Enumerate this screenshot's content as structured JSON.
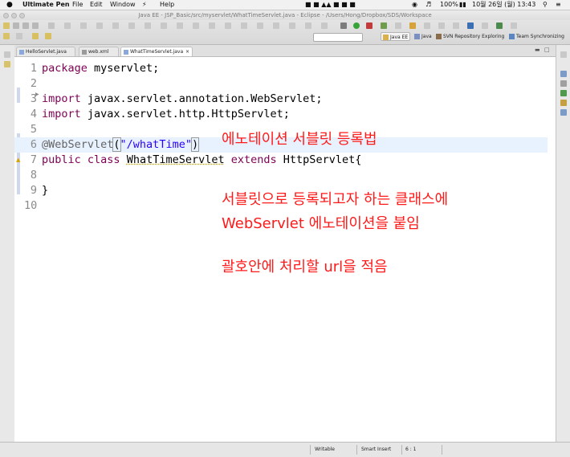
{
  "menubar": {
    "app_name": "Ultimate Pen",
    "items": [
      "File",
      "Edit",
      "Window",
      "Help"
    ],
    "battery": "100%",
    "clock": "10월 26일 (월)  13:43"
  },
  "window": {
    "title": "Java EE - JSP_Basic/src/myservlet/WhatTimeServlet.java - Eclipse - /Users/Hong/Dropbox/SDS/Workspace"
  },
  "perspectives": [
    "Java EE",
    "Java",
    "SVN Repository Exploring",
    "Team Synchronizing"
  ],
  "tabs": [
    {
      "label": "HelloServlet.java",
      "active": false
    },
    {
      "label": "web.xml",
      "active": false
    },
    {
      "label": "WhatTimeServlet.java",
      "active": true
    }
  ],
  "code": {
    "line_numbers": [
      "1",
      "2",
      "3",
      "4",
      "5",
      "6",
      "7",
      "8",
      "9",
      "10"
    ],
    "l1_kw": "package",
    "l1_rest": " myservlet;",
    "l3_kw": "import",
    "l3_rest": " javax.servlet.annotation.WebServlet;",
    "l4_kw": "import",
    "l4_rest": " javax.servlet.http.HttpServlet;",
    "l6_ann": "@WebServlet",
    "l6_p1": "(",
    "l6_str": "\"/whatTime\"",
    "l6_p2": ")",
    "l7_kw1": "public",
    "l7_kw2": "class",
    "l7_name": "WhatTimeServlet",
    "l7_kw3": "extends",
    "l7_rest": " HttpServlet{",
    "l9": "}"
  },
  "annotations": {
    "note1": "에노테이션 서블릿 등록법",
    "note2_line1": "서블릿으로 등록되고자 하는 클래스에",
    "note2_line2": "WebServlet 에노테이션을 붙임",
    "note3": "괄호안에 처리할 url을 적음"
  },
  "status": {
    "writable": "Writable",
    "insert_mode": "Smart Insert",
    "position": "6 : 1"
  },
  "colors": {
    "keyword": "#7f0055",
    "string": "#2a00ff",
    "annotation": "#646464",
    "note": "#ff1a1a"
  }
}
